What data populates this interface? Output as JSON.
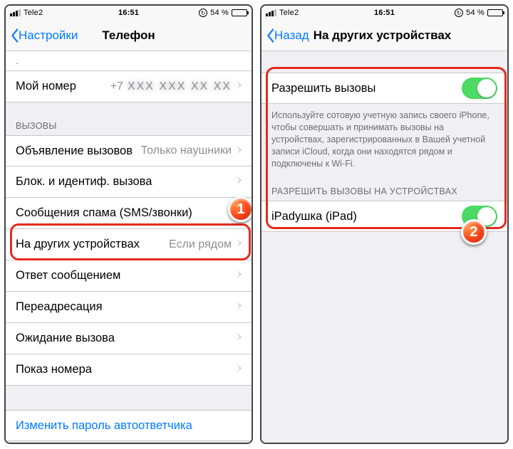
{
  "status": {
    "carrier": "Tele2",
    "time": "16:51",
    "battery_pct": "54 %",
    "lock_glyph": "⟳"
  },
  "left": {
    "back_label": "Настройки",
    "title": "Телефон",
    "my_number": {
      "label": "Мой номер",
      "prefix": "+7",
      "masked": "XXX XXX XX XX"
    },
    "section_calls": "ВЫЗОВЫ",
    "rows": {
      "announce": {
        "label": "Объявление вызовов",
        "value": "Только наушники"
      },
      "block_id": {
        "label": "Блок. и идентиф. вызова"
      },
      "spam": {
        "label": "Сообщения спама (SMS/звонки)"
      },
      "other_devices": {
        "label": "На других устройствах",
        "value": "Если рядом"
      },
      "reply_msg": {
        "label": "Ответ сообщением"
      },
      "forwarding": {
        "label": "Переадресация"
      },
      "call_waiting": {
        "label": "Ожидание вызова"
      },
      "caller_id": {
        "label": "Показ номера"
      }
    },
    "voicemail_link": "Изменить пароль автоответчика"
  },
  "right": {
    "back_label": "Назад",
    "title": "На других устройствах",
    "allow_calls": {
      "label": "Разрешить вызовы"
    },
    "allow_calls_footer": "Используйте сотовую учетную запись своего iPhone, чтобы совершать и принимать вызовы на устройствах, зарегистрированных в Вашей учетной записи iCloud, когда они находятся рядом и подключены к Wi-Fi.",
    "section_devices": "РАЗРЕШИТЬ ВЫЗОВЫ НА УСТРОЙСТВАХ",
    "device": {
      "label": "iPadушка (iPad)"
    }
  },
  "annotations": {
    "badge1": "1",
    "badge2": "2"
  }
}
